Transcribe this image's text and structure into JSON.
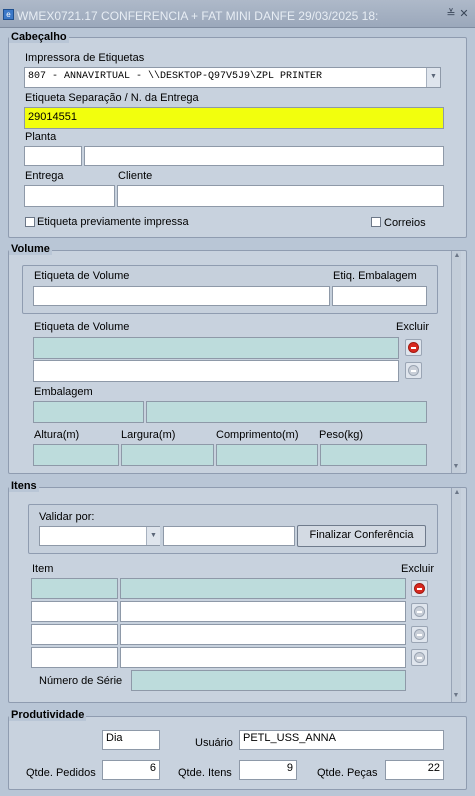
{
  "window": {
    "title": "WMEX0721.17    CONFERENCIA + FAT MINI DANFE    29/03/2025 18:",
    "minimize_glyph": "≚",
    "close_glyph": "✕"
  },
  "cabecalho": {
    "section": "Cabeçalho",
    "printer_label": "Impressora de Etiquetas",
    "printer_value": "807 - ANNAVIRTUAL      - \\\\DESKTOP-Q97V5J9\\ZPL PRINTER",
    "etiqueta_label": "Etiqueta Separação / N. da Entrega",
    "etiqueta_value": "29014551",
    "planta_label": "Planta",
    "planta_code": "",
    "planta_name": "",
    "entrega_label": "Entrega",
    "entrega_value": "",
    "cliente_label": "Cliente",
    "cliente_value": "",
    "prev_printed_label": "Etiqueta previamente impressa",
    "correios_label": "Correios"
  },
  "volume": {
    "section": "Volume",
    "etiqueta_volume_label": "Etiqueta de Volume",
    "etiq_embalagem_label": "Etiq. Embalagem",
    "list_label": "Etiqueta de Volume",
    "excluir_label": "Excluir",
    "embalagem_label": "Embalagem",
    "altura_label": "Altura(m)",
    "largura_label": "Largura(m)",
    "comprimento_label": "Comprimento(m)",
    "peso_label": "Peso(kg)"
  },
  "itens": {
    "section": "Itens",
    "validar_label": "Validar por:",
    "finalizar_label": "Finalizar Conferência",
    "item_label": "Item",
    "excluir_label": "Excluir",
    "numero_serie_label": "Número de Série"
  },
  "produtividade": {
    "section": "Produtividade",
    "periodo_value": "Dia",
    "usuario_label": "Usuário",
    "usuario_value": "PETL_USS_ANNA",
    "pedidos_label": "Qtde. Pedidos",
    "pedidos_value": "6",
    "itens_label": "Qtde. Itens",
    "itens_value": "9",
    "pecas_label": "Qtde. Peças",
    "pecas_value": "22"
  },
  "colors": {
    "highlight_field": "#f2ff0d",
    "readonly_field": "#bddcdc",
    "delete_icon": "#d8281f"
  },
  "icons": {
    "delete": "delete-icon",
    "dropdown": "chevron-down-icon",
    "scroll": "scroll-arrow-icon"
  }
}
